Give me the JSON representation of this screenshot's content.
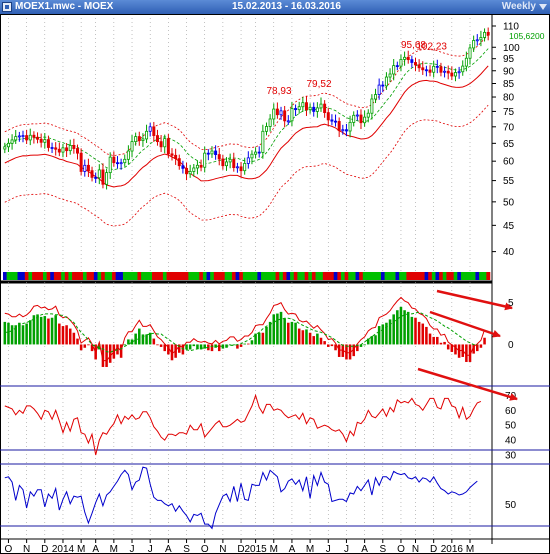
{
  "window": {
    "title": "MOEX1.mwc - MOEX",
    "date_range": "15.02.2013 - 16.03.2016",
    "period": "Weekly",
    "icon": "chart-window-icon"
  },
  "colors": {
    "up_candle": "#00a000",
    "down_candle": "#e00000",
    "neutral_candle": "#0000ee",
    "envelope_line": "#e00000",
    "inner_envelope": "#00a000",
    "ribbon_green": "#00c000",
    "ribbon_red": "#e00000",
    "ribbon_blue": "#0000cc",
    "macd_line": "#e00000",
    "macd_signal": "#00a000",
    "osc1_line": "#e00000",
    "osc2_line": "#0000cc",
    "annotation_arrow": "#e01010",
    "price_label": "#e00000",
    "current_price": "#00a000"
  },
  "price_annotations": [
    "78,93",
    "79,52",
    "95,68",
    "102,23"
  ],
  "current_price_label": "105,6200",
  "x_labels": [
    "O",
    "N",
    "D",
    "2014",
    "M",
    "A",
    "M",
    "J",
    "J",
    "A",
    "S",
    "O",
    "N",
    "D",
    "2015",
    "M",
    "A",
    "M",
    "J",
    "J",
    "A",
    "S",
    "O",
    "N",
    "D",
    "2016",
    "M"
  ],
  "chart_data": [
    {
      "type": "candlestick",
      "panel": "price",
      "y_tick_labels": [
        "110",
        "100",
        "95",
        "90",
        "85",
        "80",
        "75",
        "70",
        "65",
        "60",
        "55",
        "50",
        "45",
        "40"
      ],
      "y_scale": "log",
      "ylim": [
        37,
        113
      ],
      "x": [
        "2013-09-02",
        "2013-09-09",
        "2013-09-16",
        "2013-09-23",
        "2013-09-30",
        "2013-10-07",
        "2013-10-14",
        "2013-10-21",
        "2013-10-28",
        "2013-11-04",
        "2013-11-11",
        "2013-11-18",
        "2013-11-25",
        "2013-12-02",
        "2013-12-09",
        "2013-12-16",
        "2013-12-23",
        "2013-12-30",
        "2014-01-06",
        "2014-01-13",
        "2014-01-20",
        "2014-01-27",
        "2014-02-03",
        "2014-02-10",
        "2014-02-17",
        "2014-02-24",
        "2014-03-03",
        "2014-03-10",
        "2014-03-17",
        "2014-03-24",
        "2014-03-31",
        "2014-04-07",
        "2014-04-14",
        "2014-04-21",
        "2014-04-28",
        "2014-05-05",
        "2014-05-12",
        "2014-05-19",
        "2014-05-26",
        "2014-06-02",
        "2014-06-09",
        "2014-06-16",
        "2014-06-23",
        "2014-06-30",
        "2014-07-07",
        "2014-07-14",
        "2014-07-21",
        "2014-07-28",
        "2014-08-04",
        "2014-08-11",
        "2014-08-18",
        "2014-08-25",
        "2014-09-01",
        "2014-09-08",
        "2014-09-15",
        "2014-09-22",
        "2014-09-29",
        "2014-10-06",
        "2014-10-13",
        "2014-10-20",
        "2014-10-27",
        "2014-11-03",
        "2014-11-10",
        "2014-11-17",
        "2014-11-24",
        "2014-12-01",
        "2014-12-08",
        "2014-12-15",
        "2014-12-22",
        "2014-12-29",
        "2015-01-05",
        "2015-01-12",
        "2015-01-19",
        "2015-01-26",
        "2015-02-02",
        "2015-02-09",
        "2015-02-16",
        "2015-02-23",
        "2015-03-02",
        "2015-03-09",
        "2015-03-16",
        "2015-03-23",
        "2015-03-30",
        "2015-04-06",
        "2015-04-13",
        "2015-04-20",
        "2015-04-27",
        "2015-05-04",
        "2015-05-11",
        "2015-05-18",
        "2015-05-25",
        "2015-06-01",
        "2015-06-08",
        "2015-06-15",
        "2015-06-22",
        "2015-06-29",
        "2015-07-06",
        "2015-07-13",
        "2015-07-20",
        "2015-07-27",
        "2015-08-03",
        "2015-08-10",
        "2015-08-17",
        "2015-08-24",
        "2015-08-31",
        "2015-09-07",
        "2015-09-14",
        "2015-09-21",
        "2015-09-28",
        "2015-10-05",
        "2015-10-12",
        "2015-10-19",
        "2015-10-26",
        "2015-11-02",
        "2015-11-09",
        "2015-11-16",
        "2015-11-23",
        "2015-11-30",
        "2015-12-07",
        "2015-12-14",
        "2015-12-21",
        "2015-12-28",
        "2016-01-04",
        "2016-01-11",
        "2016-01-18",
        "2016-01-25",
        "2016-02-01",
        "2016-02-08",
        "2016-02-15",
        "2016-02-22",
        "2016-02-29",
        "2016-03-07",
        "2016-03-14"
      ],
      "close": [
        64,
        65,
        66,
        67,
        67.2,
        67.3,
        66,
        67.4,
        66.8,
        66.2,
        65.3,
        66.1,
        63.8,
        63.7,
        63.3,
        62.5,
        63.7,
        62.9,
        64.4,
        63.5,
        62.2,
        57.3,
        58.9,
        57.5,
        55.8,
        55.7,
        57.7,
        54.1,
        57,
        61.1,
        59.6,
        59.4,
        59.6,
        60.5,
        62.8,
        65.5,
        67,
        65.8,
        66.3,
        68.6,
        70,
        67.3,
        65.5,
        64,
        66.4,
        62,
        61.6,
        60.7,
        58.8,
        58.1,
        56.7,
        57.3,
        58.2,
        58.9,
        58.4,
        62.2,
        62,
        62.8,
        61.8,
        60.6,
        58.8,
        59.8,
        60.5,
        58.3,
        58.5,
        57.5,
        59.4,
        60.9,
        61.9,
        62.5,
        62.4,
        68.6,
        70.1,
        72.5,
        75.8,
        73.9,
        75.2,
        71.9,
        71.9,
        76,
        75.6,
        76.6,
        78,
        75.6,
        76.4,
        75,
        76.2,
        77.5,
        74.6,
        72.2,
        71.8,
        71.7,
        68.8,
        69.1,
        68.7,
        71.4,
        73.7,
        73.8,
        71.3,
        73.1,
        74.4,
        79.3,
        80.9,
        84.4,
        84.1,
        87.5,
        88.7,
        92.1,
        91.9,
        94.7,
        95.6,
        94.6,
        93.4,
        92.4,
        91.2,
        90.4,
        90.3,
        89.4,
        91.8,
        91.6,
        89.4,
        89.8,
        89.1,
        87.9,
        89.3,
        89.6,
        91.9,
        95.2,
        99.7,
        103.1,
        103.4,
        104.5,
        106.9,
        105.6
      ]
    },
    {
      "type": "bar+line",
      "panel": "MACD",
      "y_tick_labels": [
        "5",
        "0"
      ],
      "ylim": [
        -4.5,
        7
      ],
      "macd": [
        2.7,
        2.6,
        2.3,
        2.3,
        2.6,
        2.3,
        2.5,
        2.9,
        3.5,
        3.6,
        3.3,
        3.4,
        3.1,
        3.2,
        3.5,
        2.5,
        2.2,
        2.3,
        1.9,
        1.4,
        0.7,
        -0.7,
        -0.4,
        -0.1,
        -0.8,
        -1.8,
        -0.6,
        -2.7,
        -2.7,
        -2.2,
        -1.7,
        -1.2,
        -1.6,
        -0.1,
        0.6,
        0.6,
        1.3,
        1.9,
        1.2,
        1.2,
        1.4,
        0.7,
        0,
        -0.3,
        -0.8,
        -1.2,
        -1.9,
        -1.6,
        -1,
        -1.2,
        -0.6,
        -0.6,
        -0.2,
        -0.5,
        -0.6,
        -0.5,
        -0.7,
        -0.8,
        -0.4,
        -0.8,
        -0.5,
        -0.4,
        0,
        0,
        -0.5,
        -0.3,
        0.1,
        0.1,
        0.5,
        1.3,
        1.4,
        1.4,
        2.1,
        2.7,
        3.6,
        3.7,
        3.9,
        3.1,
        2.6,
        2.7,
        2.6,
        1.9,
        1.7,
        1.8,
        1.4,
        1,
        1.3,
        0.8,
        0.4,
        -0.3,
        -0.2,
        -0.7,
        -1.5,
        -1.5,
        -1.8,
        -1.8,
        -1.4,
        -0.8,
        -0.3,
        0,
        0.7,
        1,
        1.1,
        2.2,
        2.4,
        2.6,
        3,
        3.6,
        4.1,
        4.5,
        4.1,
        3.9,
        3.3,
        3.2,
        2.7,
        2.5,
        2.1,
        1.3,
        0.9,
        0.9,
        0.2,
        0.3,
        -0.6,
        -0.9,
        -1.2,
        -1.6,
        -1.5,
        -2.1,
        -2.1,
        -1.1,
        -0.8,
        -0.4,
        0.8
      ],
      "signal": [
        1.1,
        1.1,
        1.3,
        1.6,
        1.9,
        2.1,
        2.2,
        2.4,
        2.6,
        2.8,
        3.1,
        3.2,
        3.2,
        3.2,
        3.1,
        3.1,
        3,
        2.8,
        2.5,
        2.2,
        1.6,
        1.1,
        0.7,
        0.2,
        -0.3,
        -0.5,
        -0.7,
        -0.8,
        -1.1,
        -1.2,
        -1,
        -0.9,
        -0.8,
        -0.5,
        -0.3,
        0,
        0.2,
        0.4,
        0.6,
        0.8,
        0.9,
        1,
        0.9,
        0.9,
        0.6,
        0.3,
        0,
        -0.3,
        -0.5,
        -0.8,
        -0.9,
        -1,
        -0.9,
        -0.8,
        -0.7,
        -0.7,
        -0.6,
        -0.5,
        -0.5,
        -0.5,
        -0.5,
        -0.5,
        -0.4,
        -0.4,
        -0.3,
        -0.2,
        0,
        0.2,
        0.5,
        0.8,
        1.1,
        1.5,
        1.8,
        2,
        2.2,
        2.5,
        2.6,
        2.7,
        2.7,
        2.6,
        2.4,
        2.1,
        1.9,
        1.7,
        1.5,
        1.3,
        1.2,
        1.1,
        0.9,
        0.7,
        0.5,
        0.2,
        -0.1,
        -0.4,
        -0.5,
        -0.5,
        -0.5,
        -0.4,
        -0.3,
        0,
        0.3,
        0.6,
        0.9,
        1.2,
        1.4,
        1.7,
        2,
        2.3,
        2.6,
        2.9,
        3.1,
        3.2,
        3.2,
        3.3,
        3.4,
        3.2,
        3,
        2.8,
        2.6,
        2.4,
        2.1,
        1.8,
        1.6,
        1.3,
        1,
        0.7,
        0.4,
        0.1,
        -0.1,
        -0.3,
        -0.3
      ]
    },
    {
      "type": "line",
      "panel": "oscillator-1",
      "y_tick_labels": [
        "70",
        "60",
        "50",
        "40",
        "30"
      ],
      "ylim": [
        28,
        75
      ],
      "values": [
        63,
        62,
        61,
        57,
        60,
        58,
        63,
        63,
        61,
        58,
        54,
        60,
        59,
        54,
        60,
        53,
        45,
        52,
        46,
        54,
        55,
        45,
        44,
        38,
        44,
        30,
        40,
        45,
        44,
        48,
        51,
        57,
        51,
        56,
        54,
        57,
        54,
        55,
        59,
        59,
        55,
        49,
        46,
        42,
        40,
        44,
        44,
        43,
        45,
        45,
        44,
        50,
        47,
        47,
        51,
        42,
        45,
        48,
        51,
        53,
        49,
        49,
        50,
        52,
        54,
        52,
        53,
        58,
        63,
        70,
        62,
        58,
        64,
        64,
        60,
        61,
        60,
        57,
        55,
        56,
        57,
        54,
        58,
        51,
        55,
        54,
        48,
        49,
        50,
        49,
        47,
        46,
        47,
        44,
        39,
        46,
        43,
        52,
        51,
        54,
        60,
        56,
        55,
        58,
        61,
        56,
        62,
        59,
        67,
        65,
        66,
        65,
        68,
        64,
        63,
        60,
        64,
        68,
        68,
        62,
        61,
        68,
        68,
        63,
        62,
        55,
        62,
        54,
        56,
        61,
        65,
        66
      ]
    },
    {
      "type": "line",
      "panel": "oscillator-2",
      "y_tick_labels": [
        "50"
      ],
      "ylim": [
        20,
        86
      ],
      "values": [
        75,
        76,
        71,
        54,
        68,
        64,
        47,
        62,
        58,
        64,
        64,
        48,
        60,
        56,
        65,
        45,
        55,
        62,
        51,
        58,
        57,
        58,
        43,
        33,
        42,
        52,
        60,
        49,
        59,
        62,
        67,
        72,
        78,
        82,
        78,
        64,
        71,
        73,
        85,
        84,
        69,
        57,
        54,
        54,
        51,
        49,
        51,
        44,
        49,
        44,
        40,
        34,
        41,
        40,
        42,
        32,
        32,
        28,
        42,
        50,
        58,
        60,
        53,
        67,
        53,
        70,
        55,
        54,
        69,
        68,
        68,
        80,
        73,
        82,
        79,
        76,
        62,
        65,
        72,
        74,
        69,
        73,
        63,
        76,
        56,
        77,
        68,
        80,
        71,
        69,
        53,
        54,
        55,
        55,
        53,
        61,
        60,
        67,
        63,
        68,
        73,
        59,
        75,
        68,
        76,
        76,
        73,
        81,
        79,
        78,
        79,
        75,
        74,
        76,
        71,
        75,
        74,
        71,
        76,
        70,
        65,
        63,
        60,
        62,
        61,
        59,
        60,
        62,
        66,
        69,
        72
      ]
    }
  ]
}
